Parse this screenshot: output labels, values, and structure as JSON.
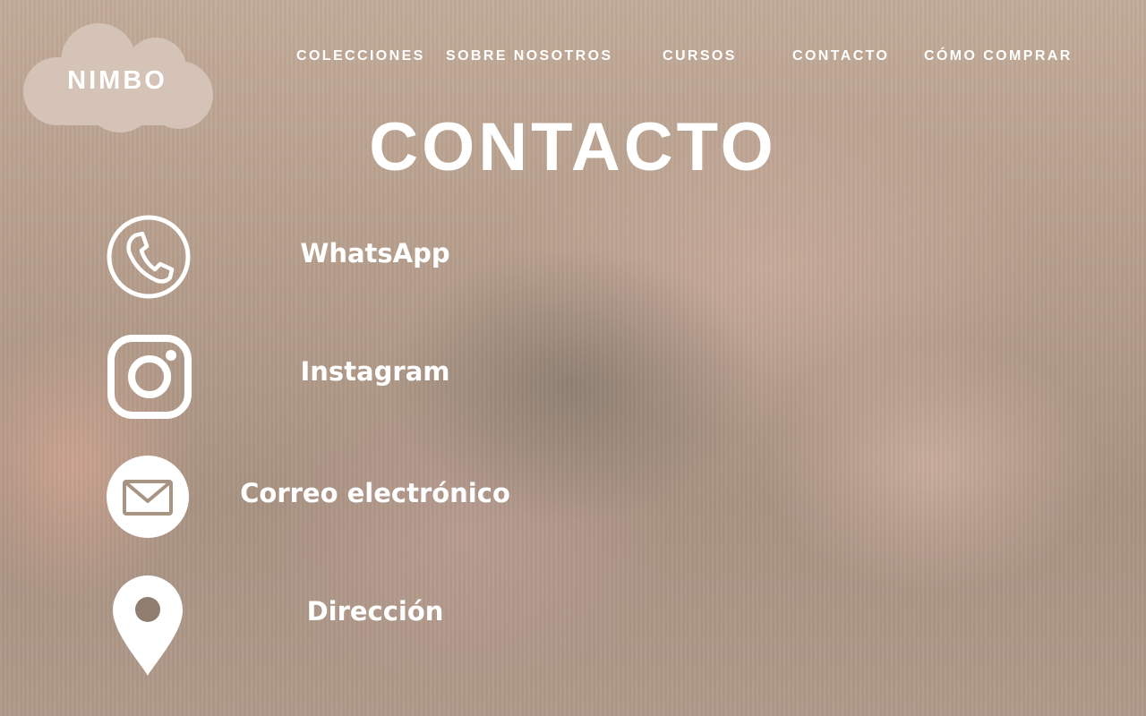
{
  "logo": {
    "text": "NIMBO"
  },
  "nav": {
    "items": [
      {
        "label": "COLECCIONES"
      },
      {
        "label": "SOBRE NOSOTROS"
      },
      {
        "label": "CURSOS"
      },
      {
        "label": "CONTACTO"
      },
      {
        "label": "CÓMO COMPRAR"
      }
    ]
  },
  "main": {
    "title": "CONTACTO",
    "contacts": [
      {
        "label": "WhatsApp",
        "icon": "phone-icon"
      },
      {
        "label": "Instagram",
        "icon": "instagram-icon"
      },
      {
        "label": "Correo electrónico",
        "icon": "mail-icon"
      },
      {
        "label": "Dirección",
        "icon": "location-pin-icon"
      }
    ]
  },
  "colors": {
    "logo_cloud": "#d4c3b6",
    "text": "#ffffff"
  }
}
